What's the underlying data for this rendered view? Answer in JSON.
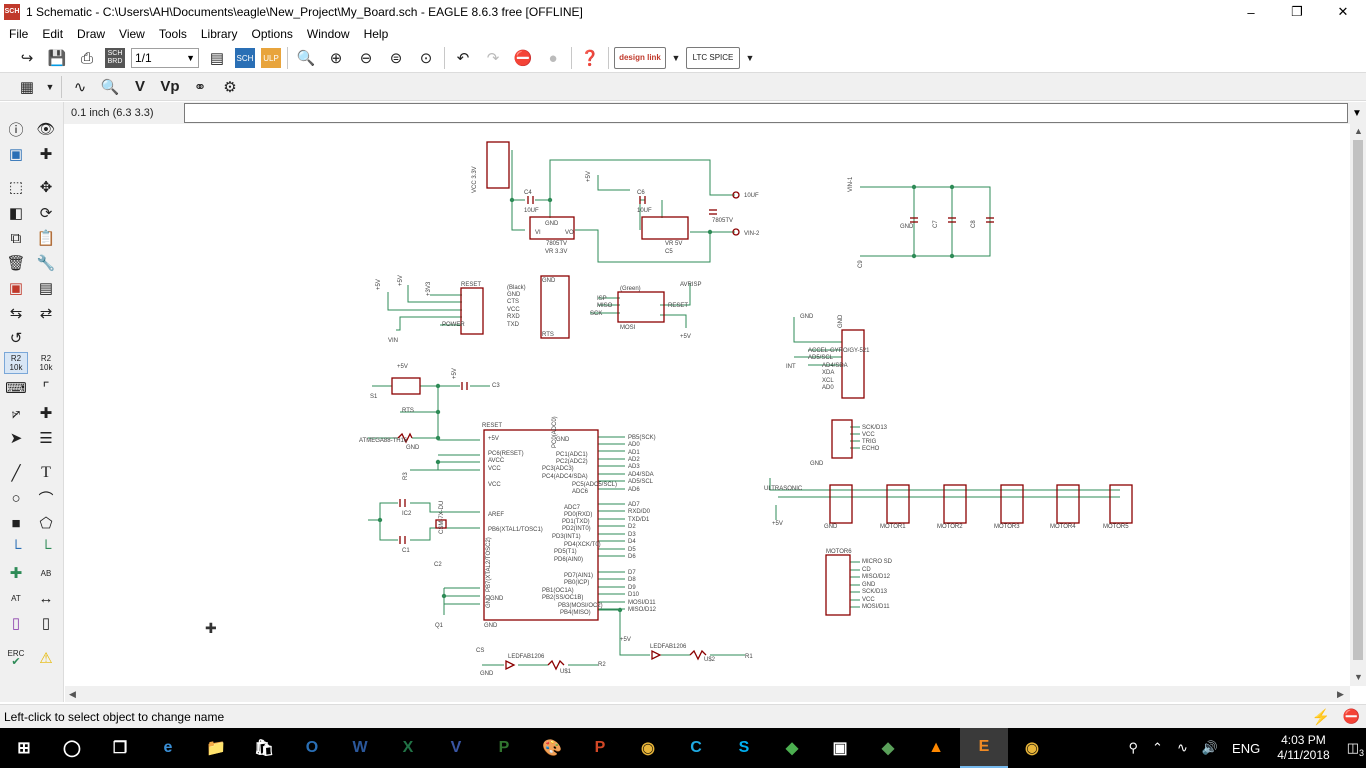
{
  "window": {
    "title": "1 Schematic - C:\\Users\\AH\\Documents\\eagle\\New_Project\\My_Board.sch - EAGLE 8.6.3 free [OFFLINE]",
    "app_icon_text": "SCH"
  },
  "menu": [
    "File",
    "Edit",
    "Draw",
    "View",
    "Tools",
    "Library",
    "Options",
    "Window",
    "Help"
  ],
  "toolbar": {
    "sheet_select": "1/1",
    "sch_label": "SCH",
    "brd_label": "BRD",
    "design_link": "design link",
    "ltc_spice": "LTC SPICE"
  },
  "coordinate_display": "0.1 inch (6.3 3.3)",
  "command_input": "",
  "status_message": "Left-click to select object to change name",
  "palette": {
    "r2_label": "R2",
    "r2_value": "10k",
    "r2b_label": "R2",
    "r2b_value": "10k",
    "text_tool": "T",
    "erc": "ERC",
    "at_label": "AT",
    "ab_label": "AB"
  },
  "schematic": {
    "texts": [
      "VCC 3.3V",
      "C4",
      "10UF",
      "GND",
      "VI",
      "VO",
      "7805TV",
      "VR 3.3V",
      "+5V",
      "C6",
      "10UF",
      "7805TV",
      "VR 5V",
      "C5",
      "10UF",
      "VIN-2",
      "VIN-1",
      "GND",
      "C7",
      "C8",
      "C9",
      "+5V",
      "+5V",
      "+3V3",
      "RESET",
      "POWER",
      "VIN",
      "GND",
      "(Black)",
      "GND",
      "CTS",
      "VCC",
      "RXD",
      "TXD",
      "RTS",
      "(Green)",
      "ISP",
      "MISO",
      "SCK",
      "RESET",
      "MOSI",
      "AVRISP",
      "+5V",
      "GND",
      "ACCEL-GYRO/GY-521",
      "AD5/SCL",
      "AD4/SDA",
      "XDA",
      "XCL",
      "AD0",
      "INT",
      "GND",
      "+5V",
      "S1",
      "+5V",
      "C3",
      "RTS",
      "RESET",
      "ATMEGA88-TH16",
      "GND",
      "R3",
      "+5V",
      "PC6(RESET)",
      "AVCC",
      "VCC",
      "VCC",
      "AREF",
      "PB6(XTAL1/TOSC1)",
      "PB7(XTAL2/TOSC2)",
      "GND",
      "GND",
      "GND",
      "IC2",
      "C1",
      "C2",
      "CSM-7X-DU",
      "Q1",
      "GND",
      "PC0(ADC0)",
      "PC1(ADC1)",
      "PC2(ADC2)",
      "PC3(ADC3)",
      "PC4(ADC4/SDA)",
      "PC5(ADC5/SCL)",
      "ADC6",
      "ADC7",
      "PD0(RXD)",
      "PD1(TXD)",
      "PD2(INT0)",
      "PD3(INT1)",
      "PD4(XCK/T0)",
      "PD5(T1)",
      "PD6(AIN0)",
      "PD7(AIN1)",
      "PB0(ICP)",
      "PB1(OC1A)",
      "PB2(SS/OC1B)",
      "PB3(MOSI/OC2)",
      "PB4(MISO)",
      "PB5(SCK)",
      "AD0",
      "AD1",
      "AD2",
      "AD3",
      "AD4/SDA",
      "AD5/SCL",
      "AD6",
      "AD7",
      "RXD/D0",
      "TXD/D1",
      "D2",
      "D3",
      "D4",
      "D5",
      "D6",
      "D7",
      "D8",
      "D9",
      "D10",
      "MOSI/D11",
      "MISO/D12",
      "SCK/D13",
      "VCC",
      "TRIG",
      "ECHO",
      "GND",
      "ULTRASONIC",
      "+5V",
      "GND",
      "MOTOR1",
      "MOTOR2",
      "MOTOR3",
      "MOTOR4",
      "MOTOR5",
      "MOTOR6",
      "MICRO SD",
      "CD",
      "MISO/D12",
      "GND",
      "SCK/D13",
      "VCC",
      "MOSI/D11",
      "CS",
      "LEDFAB1206",
      "U$1",
      "R2",
      "GND",
      "+5V",
      "LEDFAB1206",
      "U$2",
      "R1",
      "GND"
    ]
  },
  "taskbar": {
    "time": "4:03 PM",
    "date": "4/11/2018",
    "language": "ENG",
    "notifications": "3"
  }
}
